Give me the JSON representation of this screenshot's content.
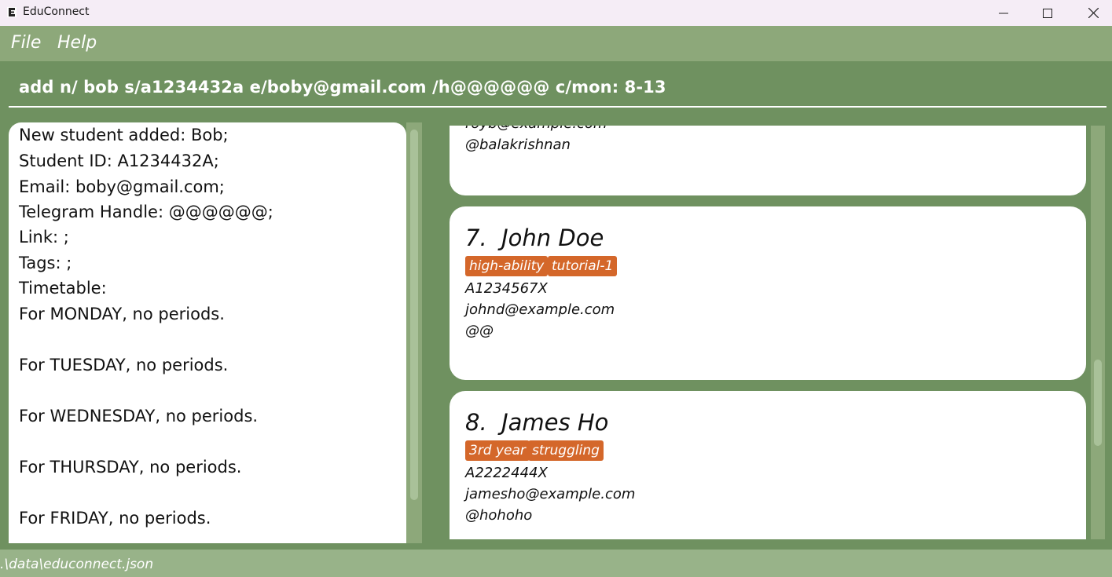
{
  "window": {
    "title": "EduConnect",
    "icon": "app-logo-icon",
    "controls": [
      "minimize-icon",
      "maximize-icon",
      "close-icon"
    ]
  },
  "menu": {
    "file_label": "File",
    "help_label": "Help"
  },
  "command": {
    "value": "add n/ bob s/a1234432a e/boby@gmail.com /h@@@@@@ c/mon: 8-13"
  },
  "result": {
    "lines": [
      "New student added: Bob;",
      "Student ID: A1234432A;",
      "Email: boby@gmail.com;",
      "Telegram Handle: @@@@@@;",
      "Link: ;",
      "Tags: ;",
      "Timetable:",
      "For MONDAY, no periods.",
      "For TUESDAY, no periods.",
      "For WEDNESDAY, no periods.",
      "For THURSDAY, no periods.",
      "For FRIDAY, no periods."
    ]
  },
  "students": [
    {
      "partial": true,
      "email": "royb@example.com",
      "telegram": "@balakrishnan"
    },
    {
      "index": "7.",
      "name": "John Doe",
      "tags": [
        "high-ability",
        "tutorial-1"
      ],
      "student_id": "A1234567X",
      "email": "johnd@example.com",
      "telegram": "@@"
    },
    {
      "index": "8.",
      "name": "James Ho",
      "tags": [
        "3rd year",
        "struggling"
      ],
      "student_id": "A2222444X",
      "email": "jamesho@example.com",
      "telegram": "@hohoho"
    }
  ],
  "status": {
    "file_path": ".\\data\\educonnect.json"
  },
  "colors": {
    "background": "#6f9160",
    "menu": "#8da87a",
    "status": "#98b389",
    "tag": "#d4672a",
    "title_bar": "#f5edf6"
  }
}
